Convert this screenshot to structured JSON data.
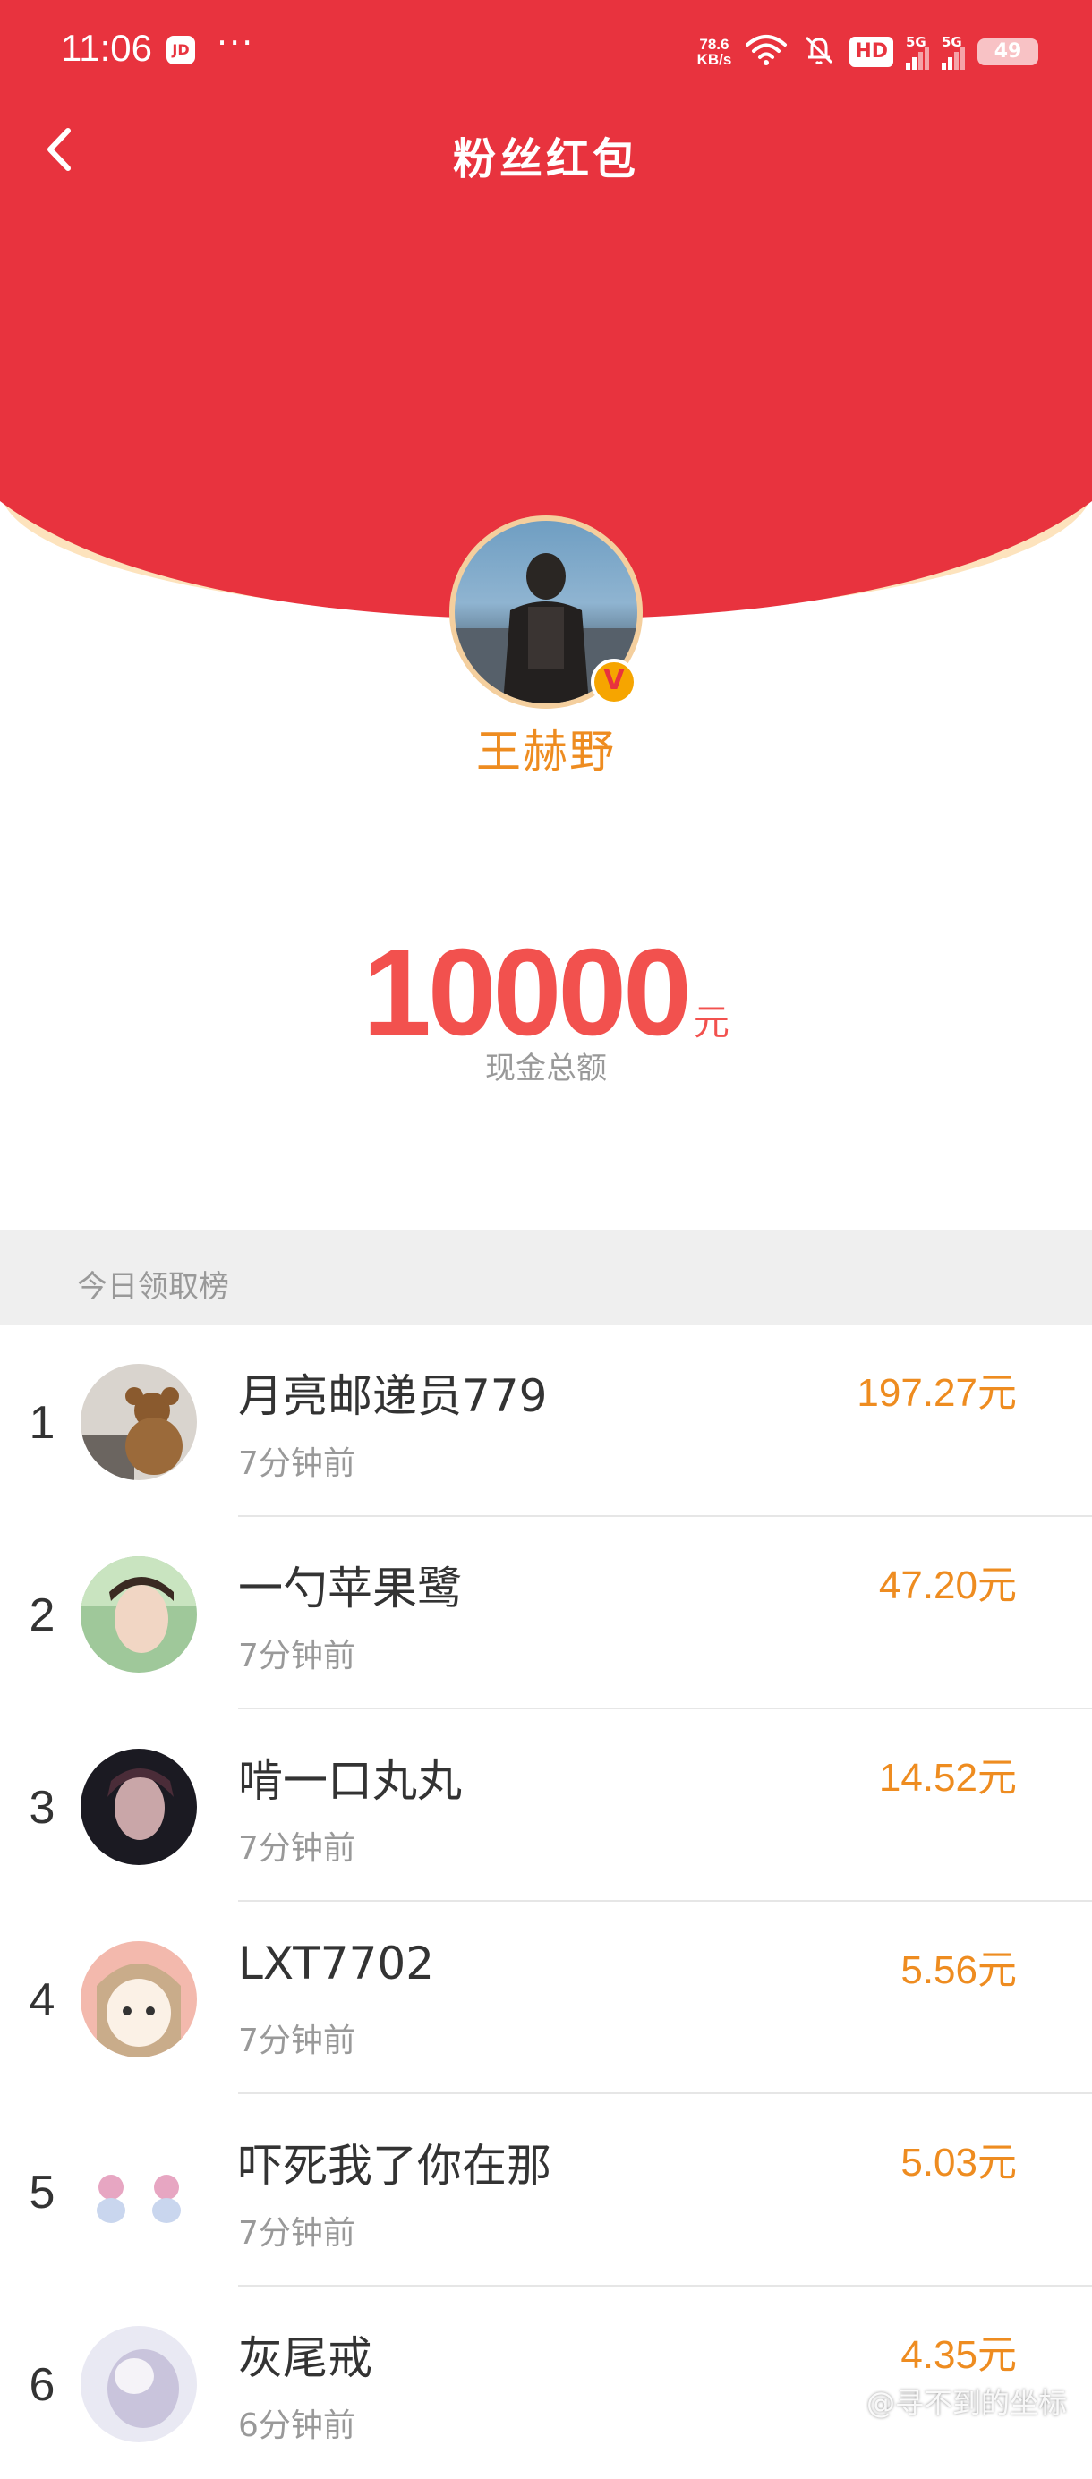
{
  "status_bar": {
    "time": "11:06",
    "app_badge": "JD",
    "more": "···",
    "net_speed_value": "78.6",
    "net_speed_unit": "KB/s",
    "hd": "HD",
    "signal_1": "5G",
    "signal_2": "5G",
    "battery": "49"
  },
  "header": {
    "title": "粉丝红包",
    "streamer_name": "王赫野",
    "verified_icon": "verified-v-icon"
  },
  "summary": {
    "amount": "10000",
    "unit": "元",
    "caption": "现金总额"
  },
  "ranking": {
    "title": "今日领取榜",
    "items": [
      {
        "rank": "1",
        "name": "月亮邮递员779",
        "time": "7分钟前",
        "amount": "197.27元"
      },
      {
        "rank": "2",
        "name": "一勺苹果鹭",
        "time": "7分钟前",
        "amount": "47.20元"
      },
      {
        "rank": "3",
        "name": "啃一口丸丸",
        "time": "7分钟前",
        "amount": "14.52元"
      },
      {
        "rank": "4",
        "name": "LXT7702",
        "time": "7分钟前",
        "amount": "5.56元"
      },
      {
        "rank": "5",
        "name": "吓死我了你在那",
        "time": "7分钟前",
        "amount": "5.03元"
      },
      {
        "rank": "6",
        "name": "灰尾戒",
        "time": "6分钟前",
        "amount": "4.35元"
      }
    ]
  },
  "watermark": "@寻不到的坐标",
  "colors": {
    "header_red": "#e8333e",
    "arc_cream": "#fde3bd",
    "amount_red": "#f2514e",
    "accent_orange": "#ee8c20",
    "section_gray": "#efefef"
  }
}
